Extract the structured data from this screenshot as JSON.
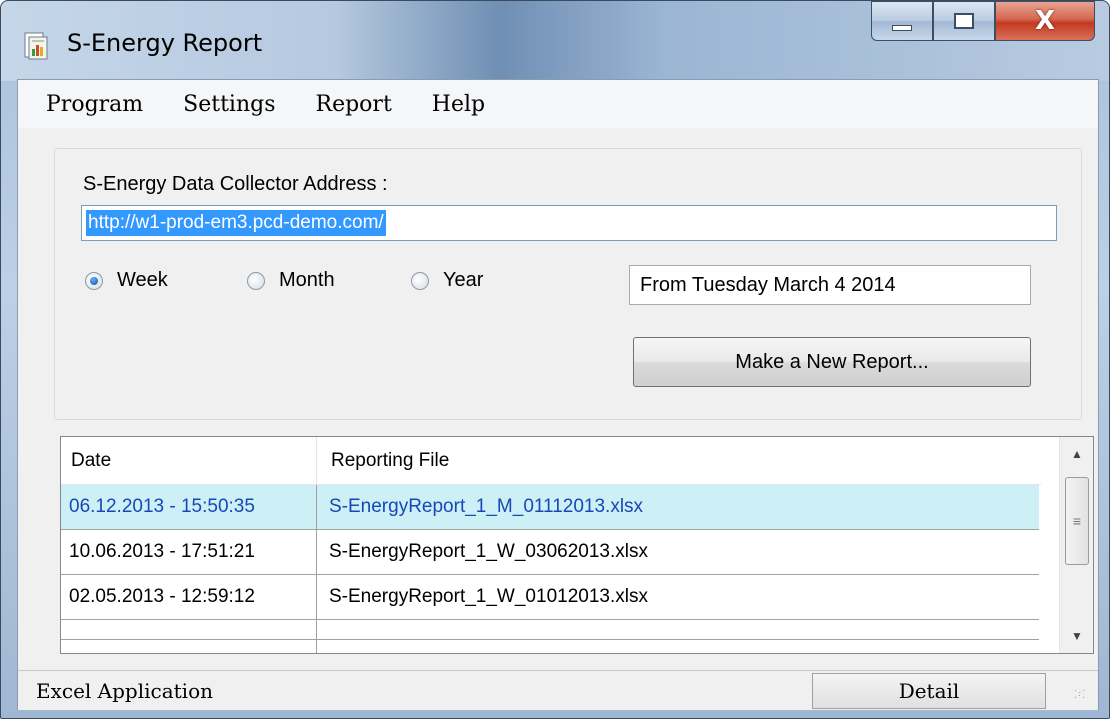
{
  "window": {
    "title": "S-Energy Report",
    "close_glyph": "X"
  },
  "menu": [
    "Program",
    "Settings",
    "Report",
    "Help"
  ],
  "collector": {
    "label": "S-Energy Data Collector Address :",
    "address": "http://w1-prod-em3.pcd-demo.com/"
  },
  "period": {
    "options": [
      "Week",
      "Month",
      "Year"
    ],
    "selected": "Week"
  },
  "date_field": "From Tuesday March 4 2014",
  "new_report_button": "Make a New Report...",
  "table": {
    "columns": [
      "Date",
      "Reporting File"
    ],
    "rows": [
      {
        "date": "06.12.2013 - 15:50:35",
        "file": "S-EnergyReport_1_M_01112013.xlsx",
        "selected": true
      },
      {
        "date": "10.06.2013 - 17:51:21",
        "file": "S-EnergyReport_1_W_03062013.xlsx",
        "selected": false
      },
      {
        "date": "02.05.2013 - 12:59:12",
        "file": "S-EnergyReport_1_W_01012013.xlsx",
        "selected": false
      }
    ]
  },
  "status": {
    "text": "Excel Application",
    "detail_button": "Detail"
  },
  "colors": {
    "selection_highlight": "#3399ff",
    "selected_row_bg": "#cdf0f6",
    "selected_row_text": "#1847b8",
    "close_button": "#c23a1f"
  },
  "icons": {
    "app": "report-document-icon",
    "minimize": "minimize-icon",
    "maximize": "maximize-icon",
    "close": "close-icon",
    "scroll_up": "chevron-up-icon",
    "scroll_down": "chevron-down-icon",
    "resize": "resize-grip-icon"
  }
}
